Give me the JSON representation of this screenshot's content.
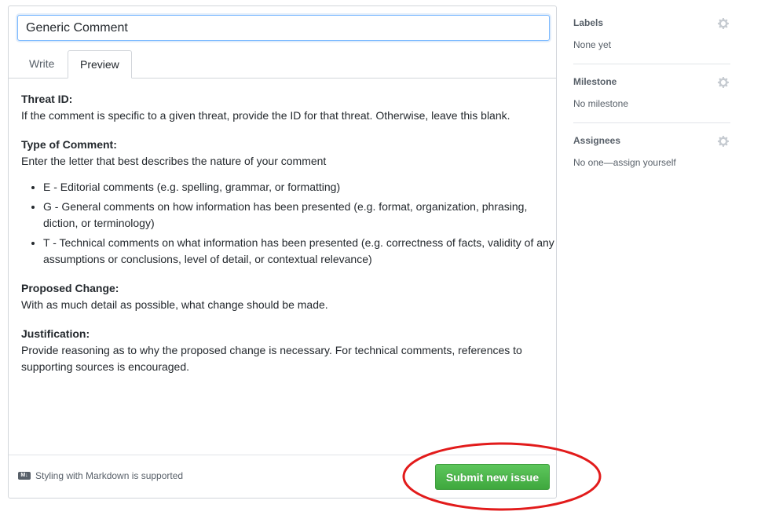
{
  "title_input": {
    "value": "Generic Comment"
  },
  "tabs": [
    {
      "label": "Write",
      "active": false
    },
    {
      "label": "Preview",
      "active": true
    }
  ],
  "preview": {
    "threat_id": {
      "heading": "Threat ID:",
      "text": "If the comment is specific to a given threat, provide the ID for that threat. Otherwise, leave this blank."
    },
    "type_of_comment": {
      "heading": "Type of Comment:",
      "text": "Enter the letter that best describes the nature of your comment",
      "items": [
        "E - Editorial comments (e.g. spelling, grammar, or formatting)",
        "G - General comments on how information has been presented (e.g. format, organization, phrasing, diction, or terminology)",
        "T - Technical comments on what information has been presented (e.g. correctness of facts, validity of any assumptions or conclusions, level of detail, or contextual relevance)"
      ]
    },
    "proposed_change": {
      "heading": "Proposed Change:",
      "text": "With as much detail as possible, what change should be made."
    },
    "justification": {
      "heading": "Justification:",
      "text": "Provide reasoning as to why the proposed change is necessary. For technical comments, references to supporting sources is encouraged."
    }
  },
  "footer": {
    "markdown_note": "Styling with Markdown is supported",
    "markdown_icon_text": "M↓",
    "submit_label": "Submit new issue"
  },
  "sidebar": {
    "labels": {
      "title": "Labels",
      "value": "None yet",
      "icon": "gear-icon"
    },
    "milestone": {
      "title": "Milestone",
      "value": "No milestone",
      "icon": "gear-icon"
    },
    "assignees": {
      "title": "Assignees",
      "value": "No one—assign yourself",
      "icon": "gear-icon"
    }
  },
  "colors": {
    "submit_green": "#3fa83e",
    "annotation_red": "#e21b1b",
    "muted_text": "#586069"
  }
}
